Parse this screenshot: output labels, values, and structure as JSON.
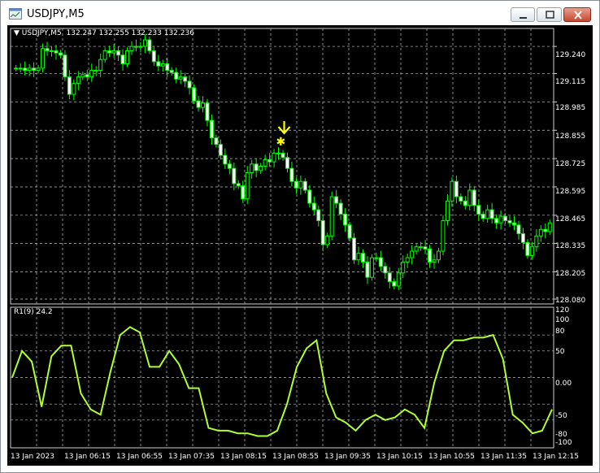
{
  "window": {
    "title": "USDJPY,M5"
  },
  "main_panel": {
    "symbol_label": "USDJPY,M5",
    "ohlc_text": "132.247 132.255 132.233 132.236",
    "y_ticks": [
      "129.240",
      "129.115",
      "128.985",
      "128.855",
      "128.725",
      "128.595",
      "128.465",
      "128.335",
      "128.205",
      "128.080"
    ]
  },
  "indicator_panel": {
    "label": "R1(9) 24.2",
    "y_ticks": [
      "120",
      "100",
      "80",
      "50",
      "0.00",
      "-50",
      "-80",
      "-100"
    ]
  },
  "x_ticks": [
    "13 Jan 2023",
    "13 Jan 06:15",
    "13 Jan 06:55",
    "13 Jan 07:35",
    "13 Jan 08:15",
    "13 Jan 08:55",
    "13 Jan 09:35",
    "13 Jan 10:15",
    "13 Jan 10:55",
    "13 Jan 11:35",
    "13 Jan 12:15"
  ],
  "colors": {
    "background": "#000000",
    "candle": "#00ff00",
    "indicator_line": "#adff2f",
    "grid": "#c0c0c0",
    "signal": "#ffff00"
  },
  "chart_data": {
    "type": "line",
    "indicator_name": "R1(9)",
    "indicator_last_value": 24.2,
    "indicator_ylim": [
      -120,
      120
    ],
    "indicator_values": [
      0,
      50,
      30,
      -55,
      40,
      60,
      60,
      -30,
      -60,
      -70,
      10,
      80,
      95,
      85,
      20,
      20,
      50,
      25,
      -20,
      -20,
      -95,
      -100,
      -100,
      -105,
      -105,
      -110,
      -110,
      -100,
      -50,
      20,
      55,
      70,
      -30,
      -75,
      -85,
      -100,
      -80,
      -70,
      -80,
      -75,
      -60,
      -70,
      -95,
      -10,
      50,
      70,
      70,
      75,
      75,
      80,
      35,
      -70,
      -85,
      -105,
      -100,
      -60
    ],
    "price_ylim": [
      128.08,
      129.3
    ],
    "signal": {
      "type": "sell-arrow",
      "price": 128.8
    }
  }
}
